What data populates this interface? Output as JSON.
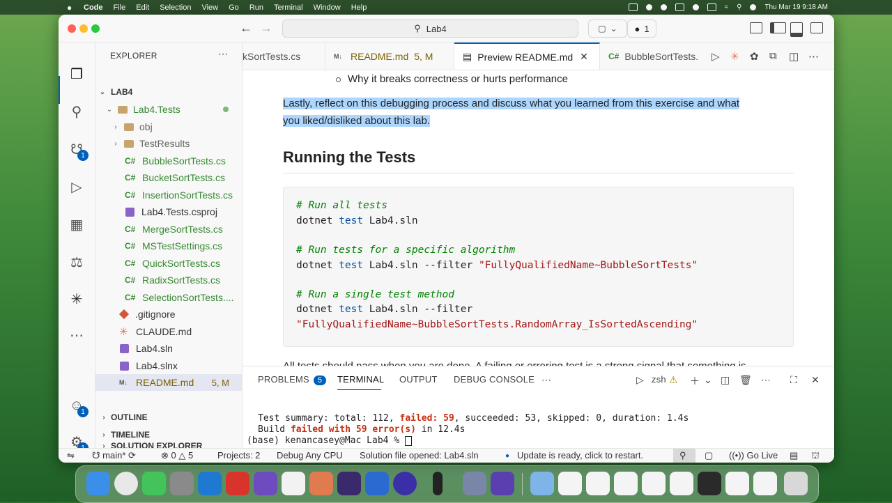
{
  "menubar": {
    "app": "Code",
    "items": [
      "File",
      "Edit",
      "Selection",
      "View",
      "Go",
      "Run",
      "Terminal",
      "Window",
      "Help"
    ],
    "clock": "Thu Mar 19  9:18 AM"
  },
  "titlebar": {
    "search": "Lab4",
    "badge_count": "1"
  },
  "activity": {
    "scm_badge": "1",
    "accounts_badge": "1",
    "settings_badge": "1"
  },
  "sidebar": {
    "title": "EXPLORER",
    "more": "⋯",
    "root": "LAB4",
    "project_folder": "Lab4.Tests",
    "folders": [
      "obj",
      "TestResults"
    ],
    "files": [
      "BubbleSortTests.cs",
      "BucketSortTests.cs",
      "InsertionSortTests.cs",
      "Lab4.Tests.csproj",
      "MergeSortTests.cs",
      "MSTestSettings.cs",
      "QuickSortTests.cs",
      "RadixSortTests.cs",
      "SelectionSortTests...."
    ],
    "root_files": [
      ".gitignore",
      "CLAUDE.md",
      "Lab4.sln",
      "Lab4.slnx",
      "README.md"
    ],
    "readme_badge": "5, M",
    "sections": [
      "OUTLINE",
      "TIMELINE",
      "SOLUTION EXPLORER"
    ]
  },
  "tabs": {
    "tab1": "kSortTests.cs",
    "tab2": "README.md",
    "tab2_badge": "5, M",
    "tab3": "Preview README.md",
    "tab4": "BubbleSortTests."
  },
  "preview": {
    "bullet": "Why it breaks correctness or hurts performance",
    "para_line1": "Lastly, reflect on this debugging process and discuss what you learned from this exercise and what",
    "para_line2": "you liked/disliked about this lab.",
    "heading": "Running the Tests",
    "code": {
      "c1": "# Run all tests",
      "cmd": "dotnet",
      "kw": "test",
      "sln": "Lab4.sln",
      "c2": "# Run tests for a specific algorithm",
      "filter": "--filter",
      "s1": "\"FullyQualifiedName~BubbleSortTests\"",
      "c3": "# Run a single test method",
      "s2": "\"FullyQualifiedName~BubbleSortTests.RandomArray_IsSortedAscending\""
    },
    "cutoff": "All tests should pass when you are done. A failing or erroring test is a strong signal that something is"
  },
  "panel": {
    "tabs": [
      "PROBLEMS",
      "TERMINAL",
      "OUTPUT",
      "DEBUG CONSOLE"
    ],
    "problems_count": "5",
    "shell": "zsh",
    "term_line1_a": "Test summary: total: 112, ",
    "term_line1_b": "failed: 59",
    "term_line1_c": ", succeeded: 53, skipped: 0, duration: 1.4s",
    "term_line2_a": "Build ",
    "term_line2_b": "failed with 59 error(s)",
    "term_line2_c": " in 12.4s",
    "term_prompt": "(base) kenancasey@Mac Lab4 % "
  },
  "status": {
    "branch": "main*",
    "errors": "0",
    "warnings": "5",
    "projects": "Projects: 2",
    "config": "Debug Any CPU",
    "solution": "Solution file opened: Lab4.sln",
    "update": "Update is ready, click to restart.",
    "golive": "Go Live"
  },
  "colors": {
    "accent": "#005fb8",
    "selection": "#add6ff",
    "csharp": "#388a34",
    "error_red": "#c72e0f"
  }
}
